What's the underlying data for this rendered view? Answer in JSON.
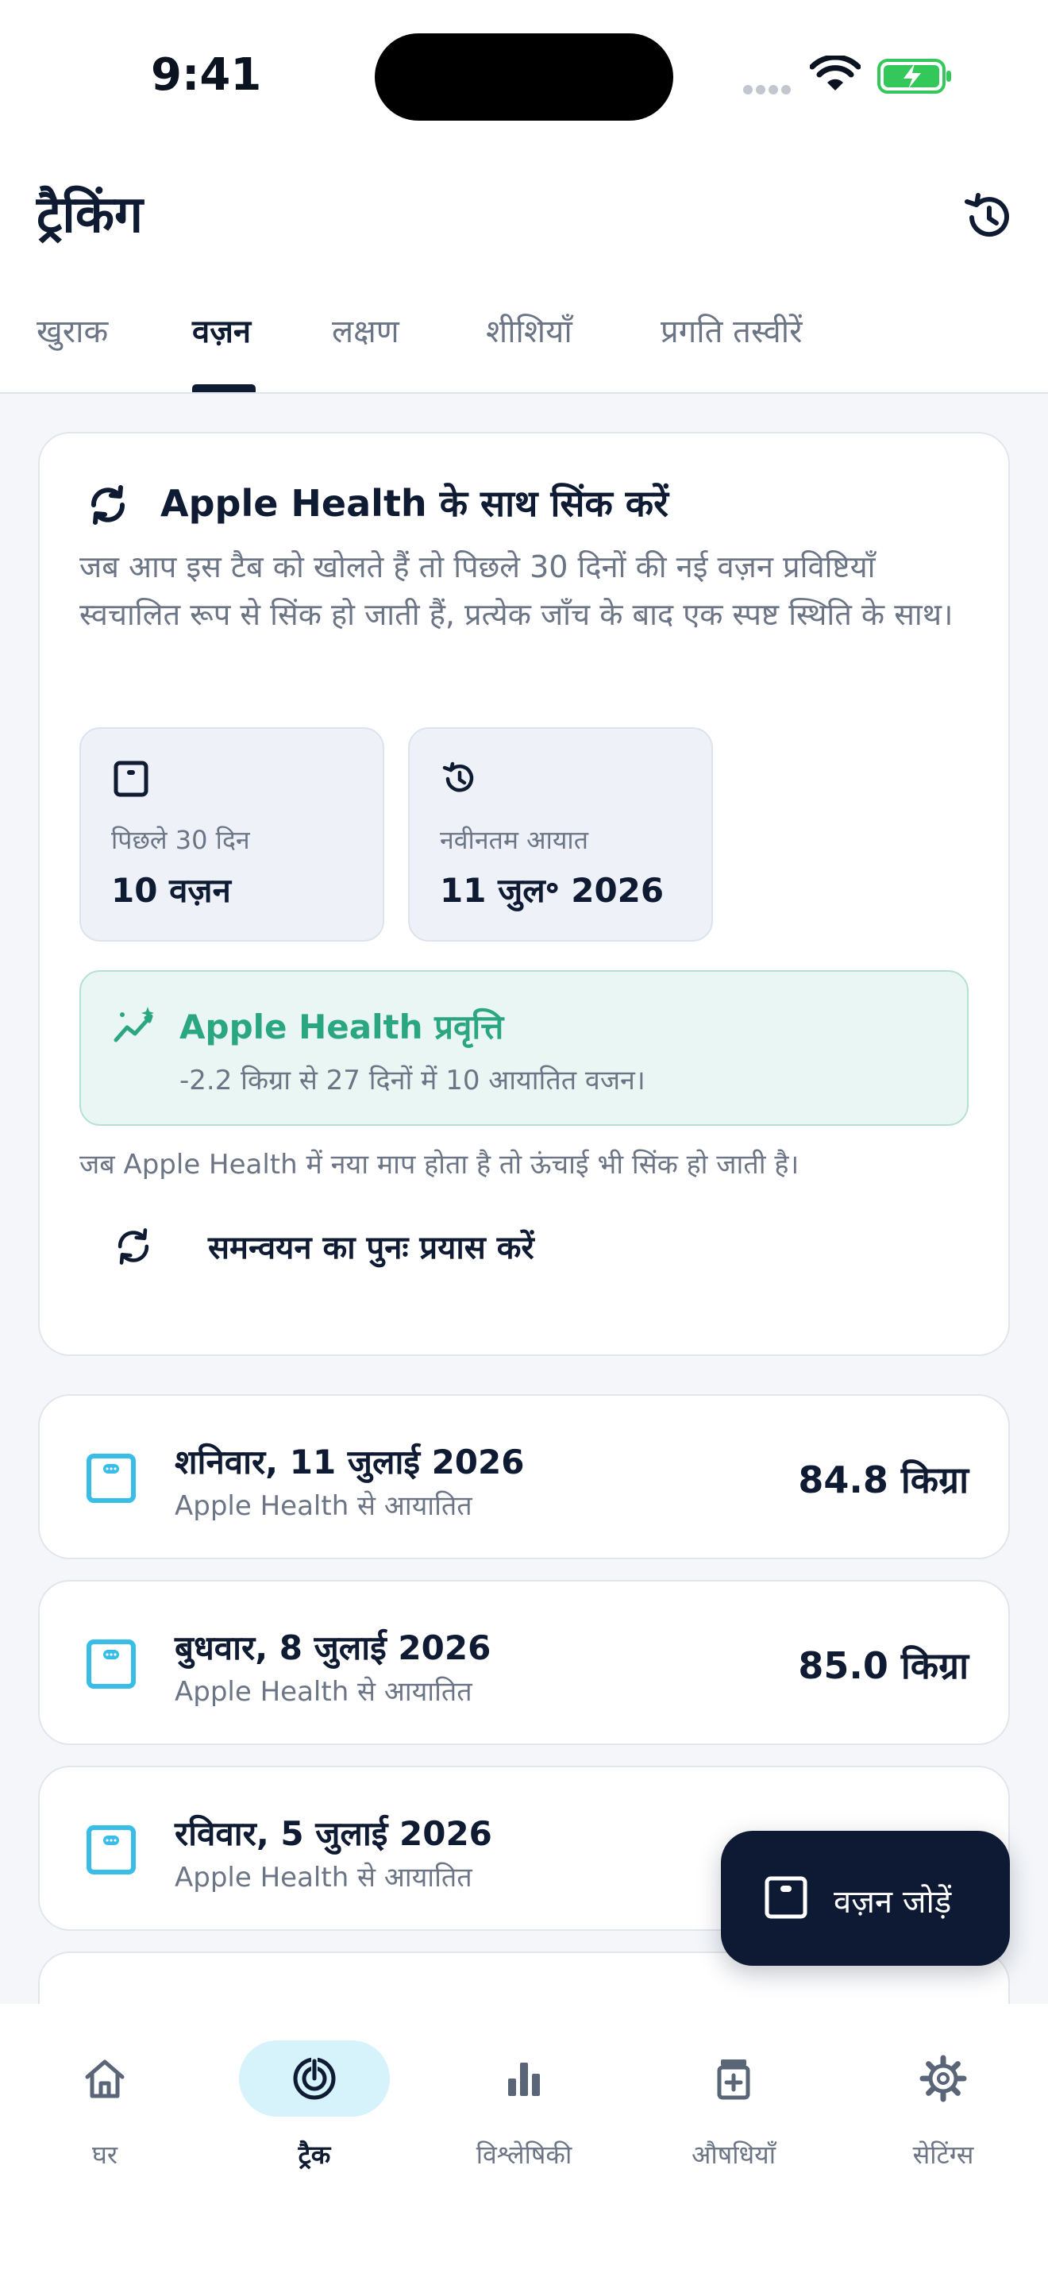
{
  "status_bar": {
    "time": "9:41"
  },
  "header": {
    "title": "ट्रैकिंग",
    "tabs": [
      {
        "label": "खुराक"
      },
      {
        "label": "वज़न",
        "active": true
      },
      {
        "label": "लक्षण"
      },
      {
        "label": "शीशियाँ"
      },
      {
        "label": "प्रगति तस्वीरें"
      }
    ]
  },
  "sync_card": {
    "title": "Apple Health के साथ सिंक करें",
    "description": "जब आप इस टैब को खोलते हैं तो पिछले 30 दिनों की नई वज़न प्रविष्टियाँ स्वचालित रूप से सिंक हो जाती हैं, प्रत्येक जाँच के बाद एक स्पष्ट स्थिति के साथ।",
    "stats": [
      {
        "label": "पिछले 30 दिन",
        "value": "10 वज़न"
      },
      {
        "label": "नवीनतम आयात",
        "value": "11 जुल॰ 2026"
      }
    ],
    "trend": {
      "title": "Apple Health प्रवृत्ति",
      "subtitle": "-2.2 किग्रा से 27 दिनों में 10 आयातित वजन।"
    },
    "height_note": "जब Apple Health में नया माप होता है तो ऊंचाई भी सिंक हो जाती है।",
    "retry_label": "समन्वयन का पुनः प्रयास करें"
  },
  "entries": [
    {
      "date": "शनिवार, 11 जुलाई 2026",
      "source": "Apple Health से आयातित",
      "weight": "84.8 किग्रा"
    },
    {
      "date": "बुधवार, 8 जुलाई 2026",
      "source": "Apple Health से आयातित",
      "weight": "85.0 किग्रा"
    },
    {
      "date": "रविवार, 5 जुलाई 2026",
      "source": "Apple Health से आयातित",
      "weight": ""
    }
  ],
  "fab": {
    "label": "वज़न जोड़ें"
  },
  "bottom_nav": [
    {
      "label": "घर",
      "icon": "home-icon"
    },
    {
      "label": "ट्रैक",
      "icon": "track-icon",
      "active": true
    },
    {
      "label": "विश्लेषिकी",
      "icon": "analytics-icon"
    },
    {
      "label": "औषधियाँ",
      "icon": "medication-icon"
    },
    {
      "label": "सेटिंग्स",
      "icon": "gear-icon"
    }
  ],
  "colors": {
    "primary_dark": "#0e1a33",
    "accent_green": "#2aa680",
    "accent_cyan": "#38bde8",
    "nav_active_bg": "#d6f2fa"
  }
}
